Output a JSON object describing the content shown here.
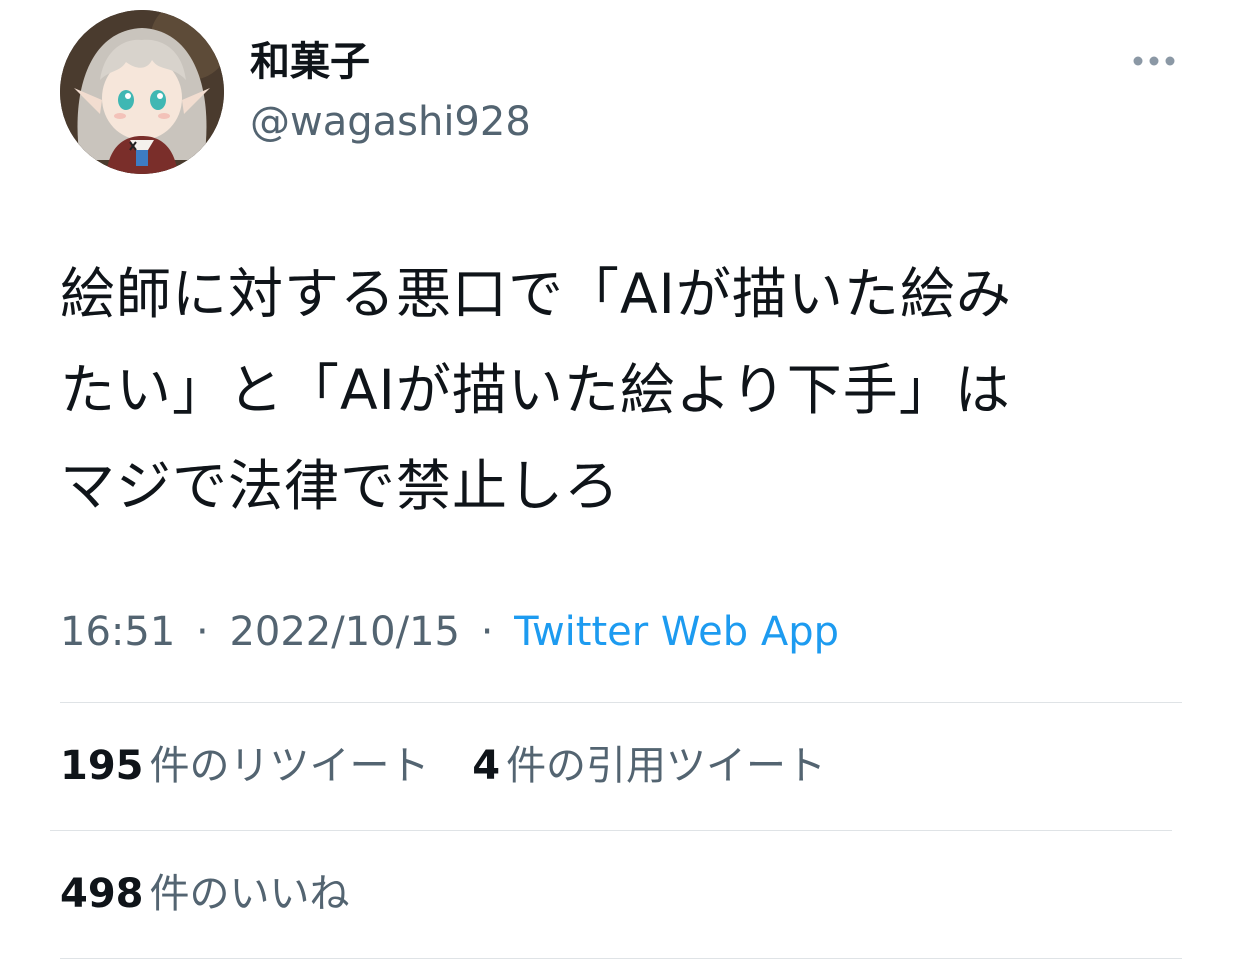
{
  "author": {
    "display_name": "和菓子",
    "handle": "@wagashi928",
    "avatar_icon": "user-avatar-icon"
  },
  "more_icon": "more-options-icon",
  "tweet": {
    "lines": [
      "絵師に対する悪口で「AIが描いた絵み",
      "たい」と「AIが描いた絵より下手」は",
      "マジで法律で禁止しろ"
    ]
  },
  "meta": {
    "time": "16:51",
    "date": "2022/10/15",
    "separator": "·",
    "source": "Twitter Web App"
  },
  "stats": {
    "retweets": {
      "count": "195",
      "label": "件のリツイート"
    },
    "quotes": {
      "count": "4",
      "label": "件の引用ツイート"
    },
    "likes": {
      "count": "498",
      "label": "件のいいね"
    }
  },
  "colors": {
    "text_primary": "#0f1419",
    "text_secondary": "#536471",
    "link": "#1d9bf0",
    "divider": "#dfe3e6"
  }
}
